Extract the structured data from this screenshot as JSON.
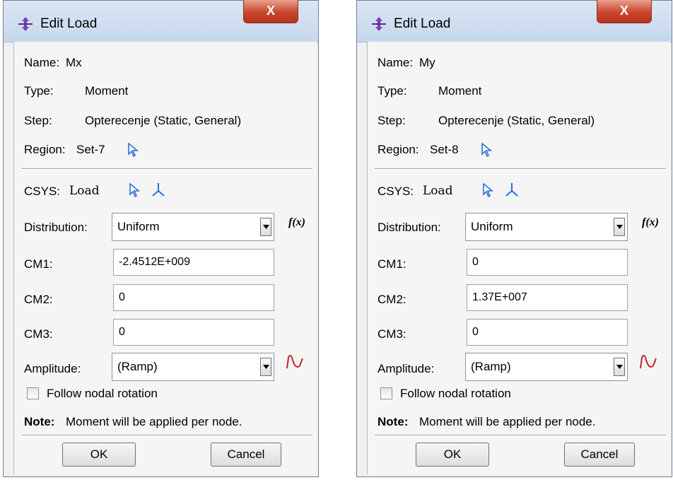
{
  "dialogs": [
    {
      "title": "Edit Load",
      "close_label": "X",
      "name_label": "Name:",
      "name_value": "Mx",
      "type_label": "Type:",
      "type_value": "Moment",
      "step_label": "Step:",
      "step_value": "Opterecenje (Static, General)",
      "region_label": "Region:",
      "region_value": "Set-7",
      "csys_label": "CSYS:",
      "csys_value": "Load",
      "distribution_label": "Distribution:",
      "distribution_value": "Uniform",
      "fx_label": "f(x)",
      "cm1_label": "CM1:",
      "cm1_value": "-2.4512E+009",
      "cm2_label": "CM2:",
      "cm2_value": "0",
      "cm3_label": "CM3:",
      "cm3_value": "0",
      "amplitude_label": "Amplitude:",
      "amplitude_value": "(Ramp)",
      "follow_label": "Follow nodal rotation",
      "note_label": "Note:",
      "note_text": "Moment will be applied per node.",
      "ok_label": "OK",
      "cancel_label": "Cancel"
    },
    {
      "title": "Edit Load",
      "close_label": "X",
      "name_label": "Name:",
      "name_value": "My",
      "type_label": "Type:",
      "type_value": "Moment",
      "step_label": "Step:",
      "step_value": "Opterecenje (Static, General)",
      "region_label": "Region:",
      "region_value": "Set-8",
      "csys_label": "CSYS:",
      "csys_value": "Load",
      "distribution_label": "Distribution:",
      "distribution_value": "Uniform",
      "fx_label": "f(x)",
      "cm1_label": "CM1:",
      "cm1_value": "0",
      "cm2_label": "CM2:",
      "cm2_value": "1.37E+007",
      "cm3_label": "CM3:",
      "cm3_value": "0",
      "amplitude_label": "Amplitude:",
      "amplitude_value": "(Ramp)",
      "follow_label": "Follow nodal rotation",
      "note_label": "Note:",
      "note_text": "Moment will be applied per node.",
      "ok_label": "OK",
      "cancel_label": "Cancel"
    }
  ],
  "icons": {
    "title": "load-arrows-icon",
    "select_region": "cursor-arrow-icon",
    "select_csys": "cursor-arrow-icon",
    "csys_axes": "coordinate-axes-icon",
    "amplitude": "amplitude-curve-icon"
  },
  "colors": {
    "close_button": "#c9462d",
    "cursor_icon": "#2f6fd6",
    "amplitude_icon": "#c0262d",
    "title_icon": "#7a3fb0"
  }
}
